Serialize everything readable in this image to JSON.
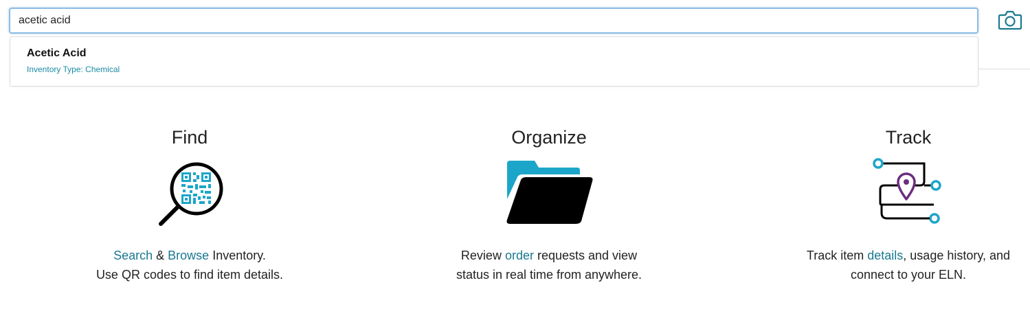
{
  "search": {
    "value": "acetic acid",
    "camera_icon": "camera-icon"
  },
  "suggestions": [
    {
      "title": "Acetic Acid",
      "subtitle": "Inventory Type: Chemical"
    }
  ],
  "features": {
    "find": {
      "title": "Find",
      "icon": "magnifier-qr-icon",
      "line1": {
        "link1": "Search",
        "sep": " & ",
        "link2": "Browse",
        "rest": " Inventory."
      },
      "line2": "Use QR codes to find item details."
    },
    "organize": {
      "title": "Organize",
      "icon": "folder-icon",
      "line1": {
        "pre": "Review ",
        "link": "order",
        "rest": " requests and view"
      },
      "line2": "status in real time from anywhere."
    },
    "track": {
      "title": "Track",
      "icon": "tracking-path-icon",
      "line1": {
        "pre": "Track item ",
        "link": "details",
        "rest": ", usage history, and"
      },
      "line2": "connect to your ELN."
    }
  },
  "colors": {
    "accent": "#1ba6c9",
    "link": "#1a7891",
    "pin": "#6b2d7f",
    "input_border": "#8cbde3"
  }
}
